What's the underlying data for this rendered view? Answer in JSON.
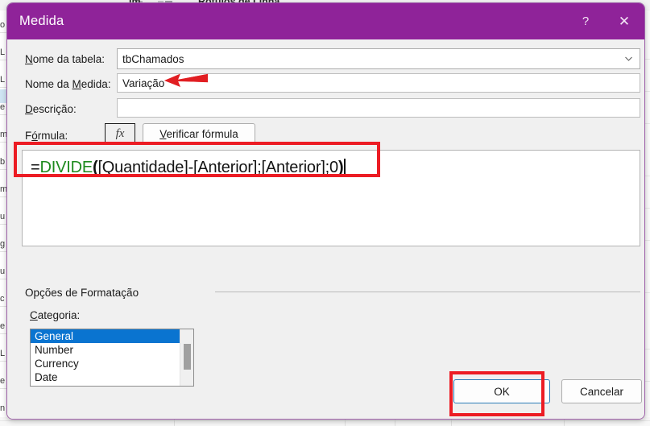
{
  "background": {
    "ribbon_cut_label": "Rótulos de Linha",
    "ribbon_cut_prefix": "Im",
    "left_column_cells": [
      "o",
      "L",
      "L",
      "e",
      "m",
      "b",
      "m",
      "u",
      "g",
      "u",
      "c",
      "e",
      "L",
      "e",
      "n"
    ]
  },
  "dialog": {
    "title": "Medida",
    "help_icon": "?",
    "close_icon": "✕",
    "fields": {
      "table_label": "Nome da tabela:",
      "table_label_accel": "N",
      "table_value": "tbChamados",
      "measure_label": "Nome da Medida:",
      "measure_label_accel": "M",
      "measure_value": "Variação",
      "description_label": "Descrição:",
      "description_label_accel": "D",
      "description_value": "",
      "formula_label": "Fórmula:",
      "formula_label_accel": "ó",
      "fx_button": "fx",
      "check_formula_button": "Verificar fórmula",
      "check_formula_accel": "V"
    },
    "formula": {
      "equals": "=",
      "function_name": "DIVIDE",
      "open_paren": "(",
      "args": "[Quantidade]-[Anterior];[Anterior];0",
      "close_paren": ")",
      "full_text": "=DIVIDE([Quantidade]-[Anterior];[Anterior];0)"
    },
    "formatting": {
      "section_title": "Opções de Formatação",
      "category_label": "Categoria:",
      "category_label_accel": "C",
      "categories": [
        "General",
        "Number",
        "Currency",
        "Date"
      ],
      "selected_category": "General"
    },
    "buttons": {
      "ok": "OK",
      "cancel": "Cancelar"
    }
  },
  "annotations": {
    "highlight_color": "#ec1c24",
    "arrow_target": "Variação",
    "boxes": [
      "formula-line",
      "ok-button"
    ]
  },
  "colors": {
    "title_bar": "#8f2399",
    "dialog_background": "#f0f0f0",
    "selection_blue": "#0a74d0",
    "function_green": "#1e8a1e",
    "annotation_red": "#ec1c24",
    "ok_focus_border": "#2b7cb8"
  }
}
